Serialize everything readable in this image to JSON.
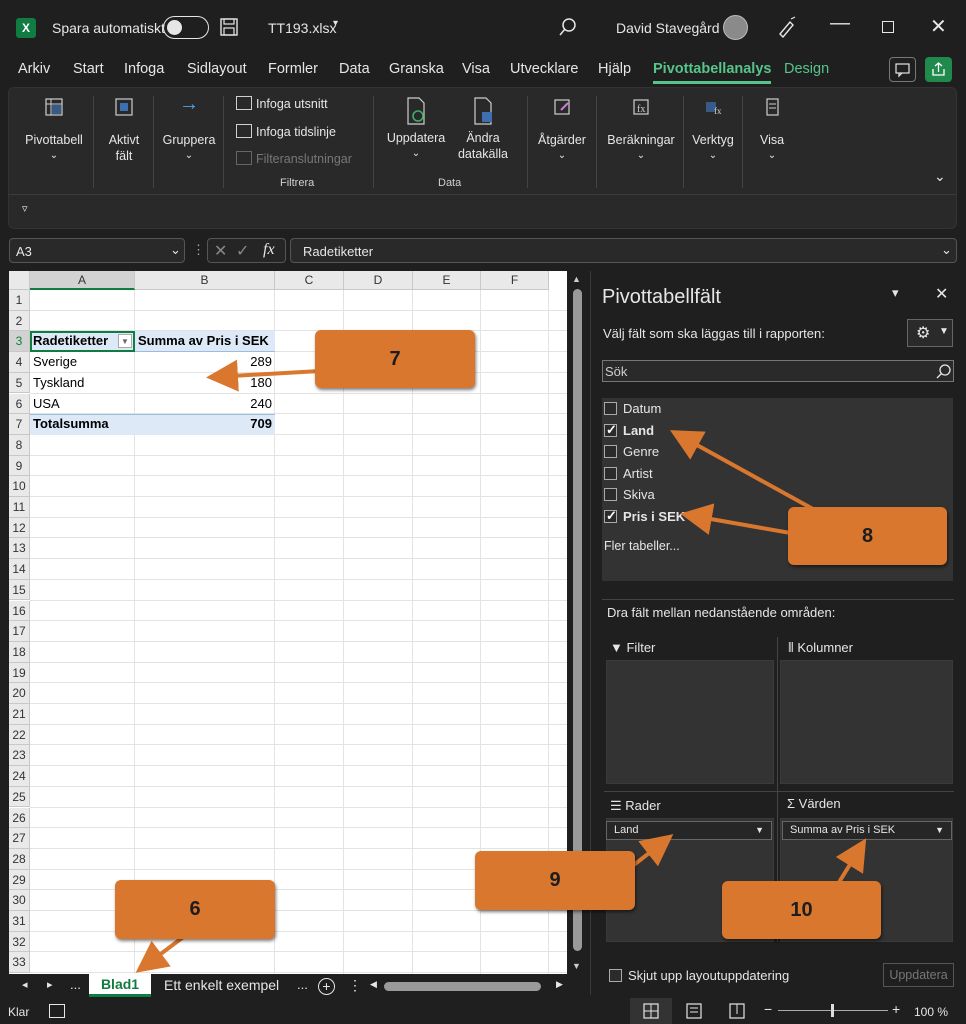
{
  "titlebar": {
    "autosave_label": "Spara automatiskt",
    "filename": "TT193.xlsx",
    "user": "David Stavegård",
    "app_icon": "X"
  },
  "menu": [
    "Arkiv",
    "Start",
    "Infoga",
    "Sidlayout",
    "Formler",
    "Data",
    "Granska",
    "Visa",
    "Utvecklare",
    "Hjälp",
    "Pivottabellanalys",
    "Design"
  ],
  "ribbon": {
    "pivottabell": "Pivottabell",
    "aktivt_falt_1": "Aktivt",
    "aktivt_falt_2": "fält",
    "gruppera": "Gruppera",
    "infoga_utsnitt": "Infoga utsnitt",
    "infoga_tidslinje": "Infoga tidslinje",
    "filteranslutningar": "Filteranslutningar",
    "filtrera_group": "Filtrera",
    "uppdatera": "Uppdatera",
    "andra_1": "Ändra",
    "andra_2": "datakälla",
    "data_group": "Data",
    "atgarder": "Åtgärder",
    "berakningar": "Beräkningar",
    "verktyg": "Verktyg",
    "visa": "Visa"
  },
  "formula": {
    "namebox": "A3",
    "content": "Radetiketter",
    "fx": "fx"
  },
  "sheet": {
    "columns": [
      "A",
      "B",
      "C",
      "D",
      "E",
      "F"
    ],
    "rows": [
      "1",
      "2",
      "3",
      "4",
      "5",
      "6",
      "7",
      "8",
      "9",
      "10",
      "11",
      "12",
      "13",
      "14",
      "15",
      "16",
      "17",
      "18",
      "19",
      "20",
      "21",
      "22",
      "23",
      "24",
      "25",
      "26",
      "27",
      "28",
      "29",
      "30",
      "31",
      "32",
      "33"
    ],
    "pivot": {
      "header_row": "Radetiketter",
      "header_values": "Summa av Pris i SEK",
      "items": [
        {
          "label": "Sverige",
          "value": "289"
        },
        {
          "label": "Tyskland",
          "value": "180"
        },
        {
          "label": "USA",
          "value": "240"
        }
      ],
      "total_label": "Totalsumma",
      "total_value": "709"
    }
  },
  "tabs": {
    "active": "Blad1",
    "other": "Ett enkelt exempel",
    "more": "..."
  },
  "pane": {
    "title": "Pivottabellfält",
    "subtitle": "Välj fält som ska läggas till i rapporten:",
    "search_placeholder": "Sök",
    "fields": [
      {
        "name": "Datum",
        "checked": false
      },
      {
        "name": "Land",
        "checked": true
      },
      {
        "name": "Genre",
        "checked": false
      },
      {
        "name": "Artist",
        "checked": false
      },
      {
        "name": "Skiva",
        "checked": false
      },
      {
        "name": "Pris i SEK",
        "checked": true
      }
    ],
    "more_tables": "Fler tabeller...",
    "drag_hint": "Dra fält mellan nedanstående områden:",
    "area_filter": "Filter",
    "area_columns": "Kolumner",
    "area_rows": "Rader",
    "area_values": "Värden",
    "rows_field": "Land",
    "values_field": "Summa av Pris i SEK",
    "defer_label": "Skjut upp layoutuppdatering",
    "update_button": "Uppdatera"
  },
  "status": {
    "ready": "Klar",
    "zoom": "100 %"
  },
  "callouts": [
    "6",
    "7",
    "8",
    "9",
    "10"
  ],
  "colors": {
    "accent": "#57c48a",
    "callout": "#d9772e",
    "excel_green": "#107c41",
    "pivot_header": "#dde9f6"
  }
}
